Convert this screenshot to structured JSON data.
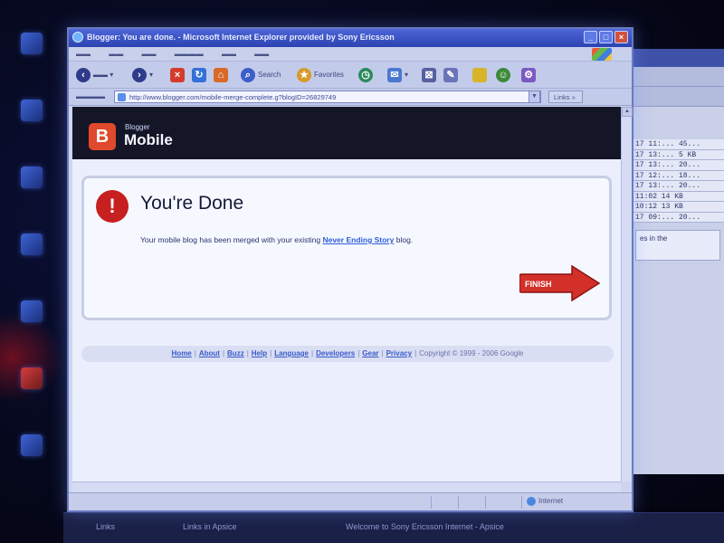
{
  "window": {
    "title": "Blogger: You are done. - Microsoft Internet Explorer provided by Sony Ericsson"
  },
  "address": {
    "url": "http://www.blogger.com/mobile-merge-complete.g?blogID=26829749",
    "links_label": "Links"
  },
  "toolbar": {
    "search_label": "Search",
    "favorites_label": "Favorites"
  },
  "page": {
    "header": {
      "logo_small": "Blogger",
      "logo_large": "Mobile"
    },
    "done": {
      "title": "You're Done",
      "message_prefix": "Your mobile blog has been merged with your existing",
      "blog_link": "Never Ending Story",
      "message_suffix": "blog.",
      "finish_label": "FINISH"
    },
    "footer": {
      "links": [
        "Home",
        "About",
        "Buzz",
        "Help",
        "Language",
        "Developers",
        "Gear",
        "Privacy"
      ],
      "copyright": "Copyright © 1999 - 2006 Google"
    }
  },
  "status": {
    "zone": "Internet"
  },
  "background_window": {
    "rows": [
      "17 11:...  45...",
      "17 13:...  5 KB",
      "17 13:...  20...",
      "17 12:...  18...",
      "17 13:...  20...",
      "11:02   14 KB",
      "10:12   13 KB",
      "17 09:...  20..."
    ],
    "panel_text": "es in the"
  },
  "taskbar": {
    "item1": "Links",
    "item2": "Links in Apsice",
    "item3": "Welcome to Sony Ericsson Internet - Apsice"
  },
  "colors": {
    "accent_red": "#c72020",
    "link_blue": "#2f5ed8",
    "header_dark": "#141627"
  }
}
